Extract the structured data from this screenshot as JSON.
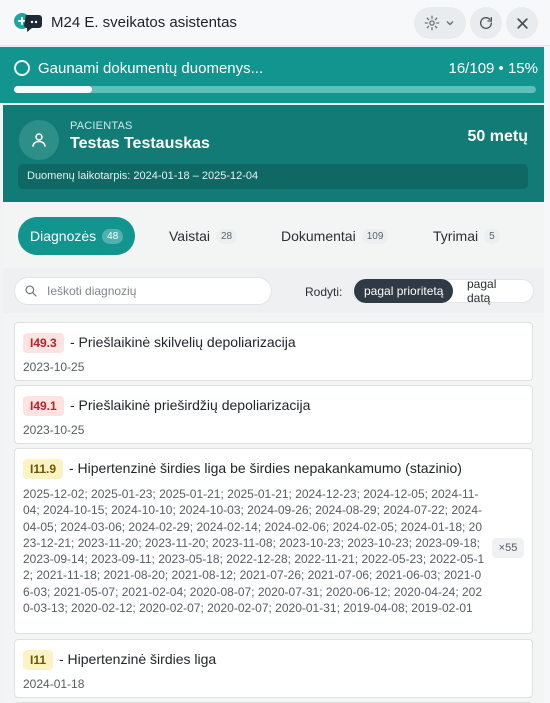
{
  "app": {
    "title": "M24 E. sveikatos asistentas"
  },
  "progress": {
    "text": "Gaunami dokumentų duomenys...",
    "count": "16/109 • 15%",
    "fraction": 0.15
  },
  "patient": {
    "label": "PACIENTAS",
    "name": "Testas Testauskas",
    "age": "50 metų",
    "period": "Duomenų laikotarpis: 2024-01-18 – 2025-12-04"
  },
  "tabs": [
    {
      "label": "Diagnozės",
      "count": "48",
      "active": true
    },
    {
      "label": "Vaistai",
      "count": "28",
      "active": false
    },
    {
      "label": "Dokumentai",
      "count": "109",
      "active": false
    },
    {
      "label": "Tyrimai",
      "count": "5",
      "active": false
    }
  ],
  "search": {
    "placeholder": "Ieškoti diagnozių"
  },
  "sort": {
    "label": "Rodyti:",
    "options": [
      "pagal prioritetą",
      "pagal datą"
    ],
    "selected": "pagal prioritetą"
  },
  "diagnoses": [
    {
      "code": "I49.3",
      "name": "- Priešlaikinė skilvelių depoliarizacija",
      "date": "2023-10-25",
      "color": "red"
    },
    {
      "code": "I49.1",
      "name": "- Priešlaikinė prieširdžių depoliarizacija",
      "date": "2023-10-25",
      "color": "red"
    },
    {
      "code": "I11.9",
      "name": "- Hipertenzinė širdies liga be širdies nepakankamumo (stazinio)",
      "dates": "2025-12-02; 2025-01-23; 2025-01-21; 2025-01-21; 2024-12-23; 2024-12-05; 2024-11-04; 2024-10-15; 2024-10-10; 2024-10-03; 2024-09-26; 2024-08-29; 2024-07-22; 2024-04-05; 2024-03-06; 2024-02-29; 2024-02-14; 2024-02-06; 2024-02-05; 2024-01-18; 2023-12-21; 2023-11-20; 2023-11-20; 2023-11-08; 2023-10-23; 2023-10-23; 2023-09-18; 2023-09-14; 2023-09-11; 2023-05-18; 2022-12-28; 2022-11-21; 2022-05-23; 2022-05-12; 2021-11-18; 2021-08-20; 2021-08-12; 2021-07-26; 2021-07-06; 2021-06-03; 2021-06-03; 2021-05-07; 2021-02-04; 2020-08-07; 2020-07-31; 2020-06-12; 2020-04-24; 2020-03-13; 2020-02-12; 2020-02-07; 2020-02-07; 2020-01-31; 2019-04-08; 2019-02-01",
      "times": "×55",
      "color": "yellow"
    },
    {
      "code": "I11",
      "name": "- Hipertenzinė širdies liga",
      "date": "2024-01-18",
      "color": "yellow"
    }
  ],
  "colors": {
    "accent": "#12948f",
    "header_teal": "#137b76",
    "red_badge": "#fde3e2",
    "yellow_badge": "#fcf3c5"
  },
  "icons": {
    "logo": "medical-chat-icon",
    "settings": "gear-icon",
    "dropdown": "chevron-down-icon",
    "refresh": "refresh-icon",
    "close": "close-icon",
    "avatar": "user-icon",
    "search": "search-icon"
  }
}
